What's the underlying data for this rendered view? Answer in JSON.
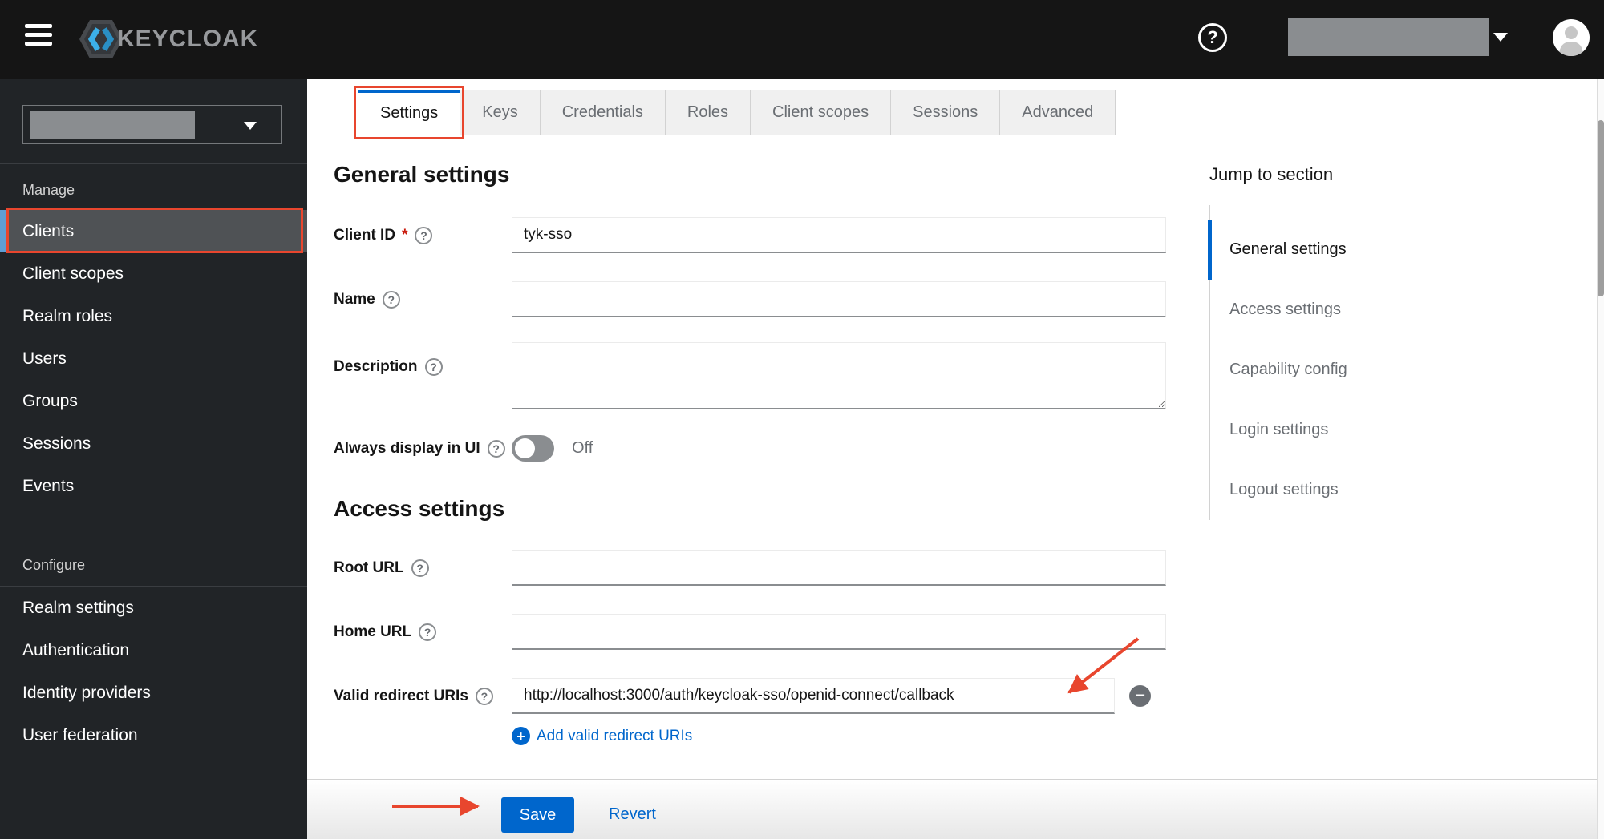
{
  "topbar": {
    "brand": "KEYCLOAK"
  },
  "glyphs": {
    "question": "?",
    "plus": "+",
    "minus": "−"
  },
  "sidebar": {
    "groups": [
      {
        "label": "Manage",
        "items": [
          {
            "label": "Clients",
            "active": true
          },
          {
            "label": "Client scopes"
          },
          {
            "label": "Realm roles"
          },
          {
            "label": "Users"
          },
          {
            "label": "Groups"
          },
          {
            "label": "Sessions"
          },
          {
            "label": "Events"
          }
        ]
      },
      {
        "label": "Configure",
        "items": [
          {
            "label": "Realm settings"
          },
          {
            "label": "Authentication"
          },
          {
            "label": "Identity providers"
          },
          {
            "label": "User federation"
          }
        ]
      }
    ]
  },
  "tabs": [
    {
      "label": "Settings",
      "active": true
    },
    {
      "label": "Keys"
    },
    {
      "label": "Credentials"
    },
    {
      "label": "Roles"
    },
    {
      "label": "Client scopes"
    },
    {
      "label": "Sessions"
    },
    {
      "label": "Advanced"
    }
  ],
  "form": {
    "general_heading": "General settings",
    "access_heading": "Access settings",
    "client_id": {
      "label": "Client ID",
      "required": "*",
      "value": "tyk-sso"
    },
    "name": {
      "label": "Name",
      "value": ""
    },
    "description": {
      "label": "Description",
      "value": ""
    },
    "always_display": {
      "label": "Always display in UI",
      "state": "Off"
    },
    "root_url": {
      "label": "Root URL",
      "value": ""
    },
    "home_url": {
      "label": "Home URL",
      "value": ""
    },
    "valid_redirect": {
      "label": "Valid redirect URIs",
      "value": "http://localhost:3000/auth/keycloak-sso/openid-connect/callback"
    },
    "add_redirect_label": "Add valid redirect URIs"
  },
  "jump": {
    "heading": "Jump to section",
    "items": [
      {
        "label": "General settings",
        "active": true
      },
      {
        "label": "Access settings"
      },
      {
        "label": "Capability config"
      },
      {
        "label": "Login settings"
      },
      {
        "label": "Logout settings"
      }
    ]
  },
  "footer": {
    "save": "Save",
    "revert": "Revert"
  },
  "colors": {
    "accent": "#0066cc",
    "annotation": "#e8462e",
    "danger": "#c9190b",
    "nav_current_bar": "#5e9fd6",
    "redacted": "#8a8d90"
  }
}
